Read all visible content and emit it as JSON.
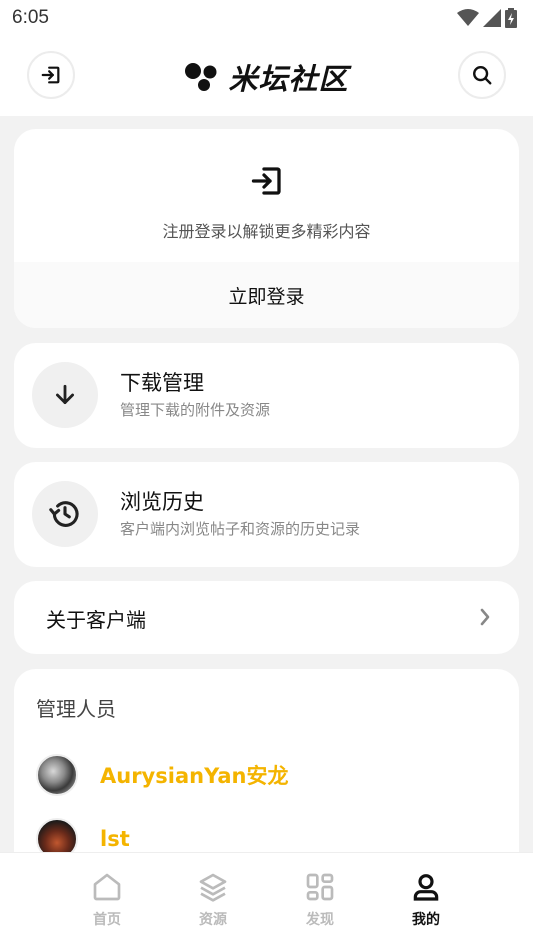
{
  "status": {
    "time": "6:05"
  },
  "header": {
    "title": "米坛社区"
  },
  "login_card": {
    "hint": "注册登录以解锁更多精彩内容",
    "action": "立即登录"
  },
  "features": [
    {
      "title": "下载管理",
      "subtitle": "管理下载的附件及资源",
      "icon": "download-icon"
    },
    {
      "title": "浏览历史",
      "subtitle": "客户端内浏览帖子和资源的历史记录",
      "icon": "history-icon"
    }
  ],
  "about": {
    "label": "关于客户端"
  },
  "admins": {
    "heading": "管理人员",
    "members": [
      {
        "name": "AurysianYan安龙"
      },
      {
        "name": "lst"
      }
    ]
  },
  "bottom_nav": [
    {
      "label": "首页",
      "icon": "home-icon",
      "active": false
    },
    {
      "label": "资源",
      "icon": "layers-icon",
      "active": false
    },
    {
      "label": "发现",
      "icon": "grid-icon",
      "active": false
    },
    {
      "label": "我的",
      "icon": "user-icon",
      "active": true
    }
  ],
  "colors": {
    "accent": "#f4b400",
    "background": "#f2f2f2",
    "card": "#ffffff"
  }
}
